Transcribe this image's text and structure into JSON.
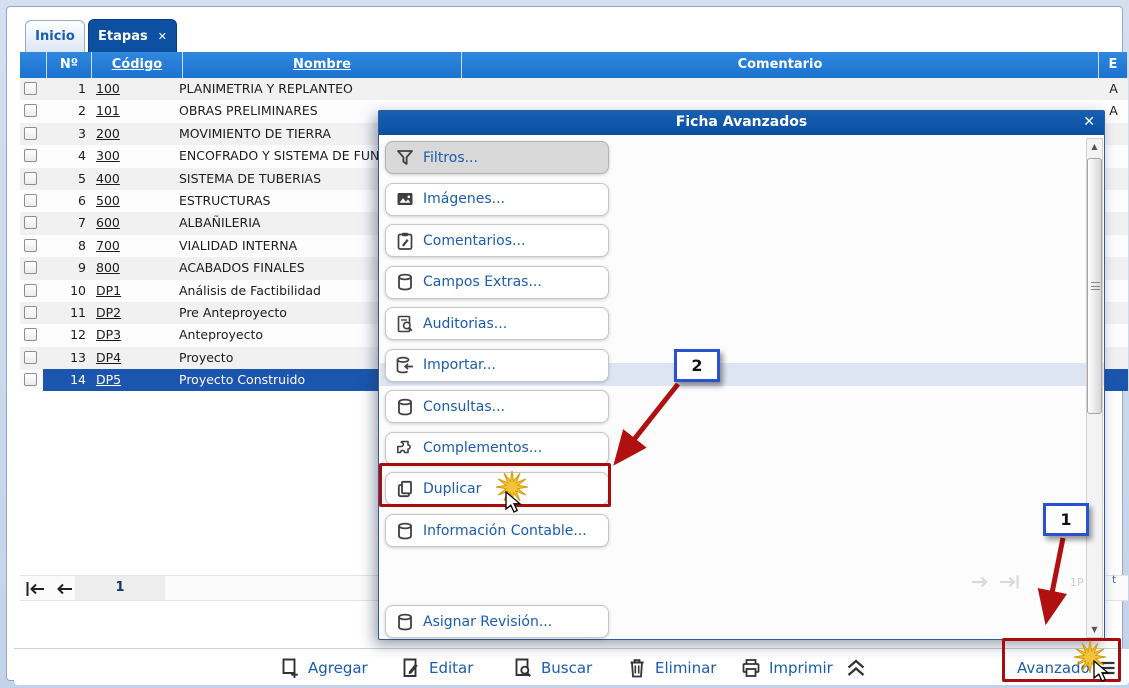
{
  "tabs": [
    {
      "label": "Inicio"
    },
    {
      "label": "Etapas",
      "close_glyph": "✕"
    }
  ],
  "table": {
    "columns": {
      "num": "Nº",
      "code": "Código",
      "name": "Nombre",
      "comment": "Comentario",
      "status": "E"
    },
    "rows": [
      {
        "num": "1",
        "code": "100",
        "name": "PLANIMETRIA Y REPLANTEO",
        "comment": "",
        "status": "A"
      },
      {
        "num": "2",
        "code": "101",
        "name": "OBRAS PRELIMINARES",
        "comment": "",
        "status": "A"
      },
      {
        "num": "3",
        "code": "200",
        "name": "MOVIMIENTO DE TIERRA",
        "comment": "",
        "status": ""
      },
      {
        "num": "4",
        "code": "300",
        "name": "ENCOFRADO Y SISTEMA DE FUND",
        "comment": "",
        "status": ""
      },
      {
        "num": "5",
        "code": "400",
        "name": "SISTEMA DE TUBERIAS",
        "comment": "",
        "status": ""
      },
      {
        "num": "6",
        "code": "500",
        "name": "ESTRUCTURAS",
        "comment": "",
        "status": ""
      },
      {
        "num": "7",
        "code": "600",
        "name": "ALBAÑILERIA",
        "comment": "",
        "status": ""
      },
      {
        "num": "8",
        "code": "700",
        "name": "VIALIDAD INTERNA",
        "comment": "",
        "status": ""
      },
      {
        "num": "9",
        "code": "800",
        "name": "ACABADOS FINALES",
        "comment": "",
        "status": ""
      },
      {
        "num": "10",
        "code": "DP1",
        "name": "Análisis de Factibilidad",
        "comment": "",
        "status": ""
      },
      {
        "num": "11",
        "code": "DP2",
        "name": "Pre Anteproyecto",
        "comment": "",
        "status": ""
      },
      {
        "num": "12",
        "code": "DP3",
        "name": "Anteproyecto",
        "comment": "",
        "status": ""
      },
      {
        "num": "13",
        "code": "DP4",
        "name": "Proyecto",
        "comment": "",
        "status": ""
      },
      {
        "num": "14",
        "code": "DP5",
        "name": "Proyecto Construido",
        "comment": "",
        "status": "",
        "selected": true
      }
    ]
  },
  "pagination": {
    "current_page": "1",
    "overlay_fragment": "1P",
    "edge_fragment": "t"
  },
  "dialog": {
    "title": "Ficha Avanzados",
    "close_glyph": "✕",
    "items": [
      {
        "label": "Filtros...",
        "icon": "filter-icon",
        "state": "hover"
      },
      {
        "label": "Imágenes...",
        "icon": "image-icon"
      },
      {
        "label": "Comentarios...",
        "icon": "comment-icon"
      },
      {
        "label": "Campos Extras...",
        "icon": "database-icon"
      },
      {
        "label": "Auditorias...",
        "icon": "audit-icon"
      },
      {
        "label": "Importar...",
        "icon": "import-icon"
      },
      {
        "label": "Consultas...",
        "icon": "database-icon"
      },
      {
        "label": "Complementos...",
        "icon": "puzzle-icon"
      },
      {
        "label": "Duplicar",
        "icon": "copy-icon",
        "state": "highlighted"
      },
      {
        "label": "Información Contable...",
        "icon": "database-icon"
      },
      {
        "label": "Asignar Revisión...",
        "icon": "database-icon",
        "position": "bottom"
      }
    ]
  },
  "toolbar": {
    "items": [
      {
        "label": "Agregar",
        "icon": "add-document-icon"
      },
      {
        "label": "Editar",
        "icon": "edit-document-icon"
      },
      {
        "label": "Buscar",
        "icon": "search-document-icon"
      },
      {
        "label": "Eliminar",
        "icon": "trash-icon"
      },
      {
        "label": "Imprimir",
        "icon": "printer-icon"
      }
    ],
    "collapse_icon": "double-chevron-up-icon",
    "advanced_label": "Avanzado",
    "advanced_icon": "menu-lines-icon"
  },
  "annotations": {
    "step1": "1",
    "step2": "2"
  },
  "colors": {
    "header_blue": "#1e7ad4",
    "dark_blue": "#0d4fa1",
    "selected_row": "#1b55ae",
    "link_blue": "#1a5cad",
    "annotation_red": "#a80d0d",
    "annotation_box_border": "#2a52cc",
    "starburst_gold": "#f5c33b"
  }
}
